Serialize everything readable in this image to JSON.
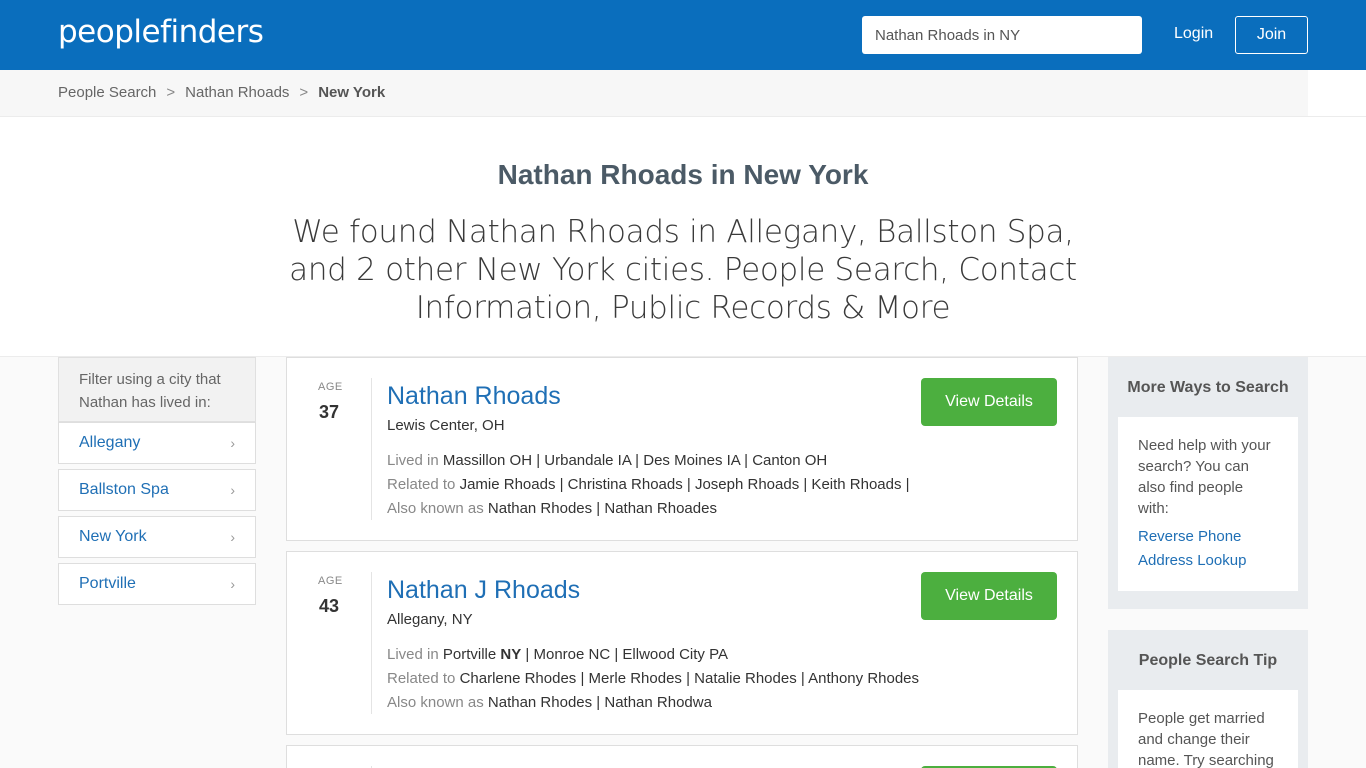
{
  "header": {
    "logo": "peoplefinders",
    "search_value": "Nathan Rhoads in NY",
    "login_label": "Login",
    "join_label": "Join"
  },
  "breadcrumb": {
    "items": [
      "People Search",
      "Nathan Rhoads",
      "New York"
    ],
    "separator": ">"
  },
  "hero": {
    "title": "Nathan Rhoads in New York",
    "subtitle": "We found Nathan Rhoads in Allegany, Ballston Spa, and 2 other New York cities. People Search, Contact Information, Public Records & More"
  },
  "filter": {
    "heading": "Filter using a city that Nathan has lived in:",
    "cities": [
      "Allegany",
      "Ballston Spa",
      "New York",
      "Portville"
    ]
  },
  "results": [
    {
      "age_label": "AGE",
      "age": "37",
      "name": "Nathan Rhoads",
      "location": "Lewis Center, OH",
      "lived_in_label": "Lived in",
      "lived_in": "Massillon OH | Urbandale IA | Des Moines IA | Canton OH",
      "related_label": "Related to",
      "related": "Jamie Rhoads | Christina Rhoads | Joseph Rhoads | Keith Rhoads |",
      "aka_label": "Also known as",
      "aka": "Nathan Rhodes | Nathan Rhoades",
      "button": "View Details"
    },
    {
      "age_label": "AGE",
      "age": "43",
      "name": "Nathan J Rhoads",
      "location": "Allegany, NY",
      "lived_in_label": "Lived in",
      "lived_in_first": "Portville",
      "lived_in_bold": "NY",
      "lived_in_rest": " | Monroe NC | Ellwood City PA",
      "related_label": "Related to",
      "related": "Charlene Rhodes | Merle Rhodes | Natalie Rhodes | Anthony Rhodes",
      "aka_label": "Also known as",
      "aka": "Nathan Rhodes | Nathan Rhodwa",
      "button": "View Details"
    }
  ],
  "sidebar": {
    "more_ways": {
      "title": "More Ways to Search",
      "text": "Need help with your search? You can also find people with:",
      "links": [
        "Reverse Phone",
        "Address Lookup"
      ]
    },
    "tip": {
      "title": "People Search Tip",
      "text": "People get married and change their name. Try searching"
    }
  },
  "colors": {
    "header_bg": "#0a6ebd",
    "link": "#1f6fb5",
    "button_green": "#4caf3f"
  }
}
